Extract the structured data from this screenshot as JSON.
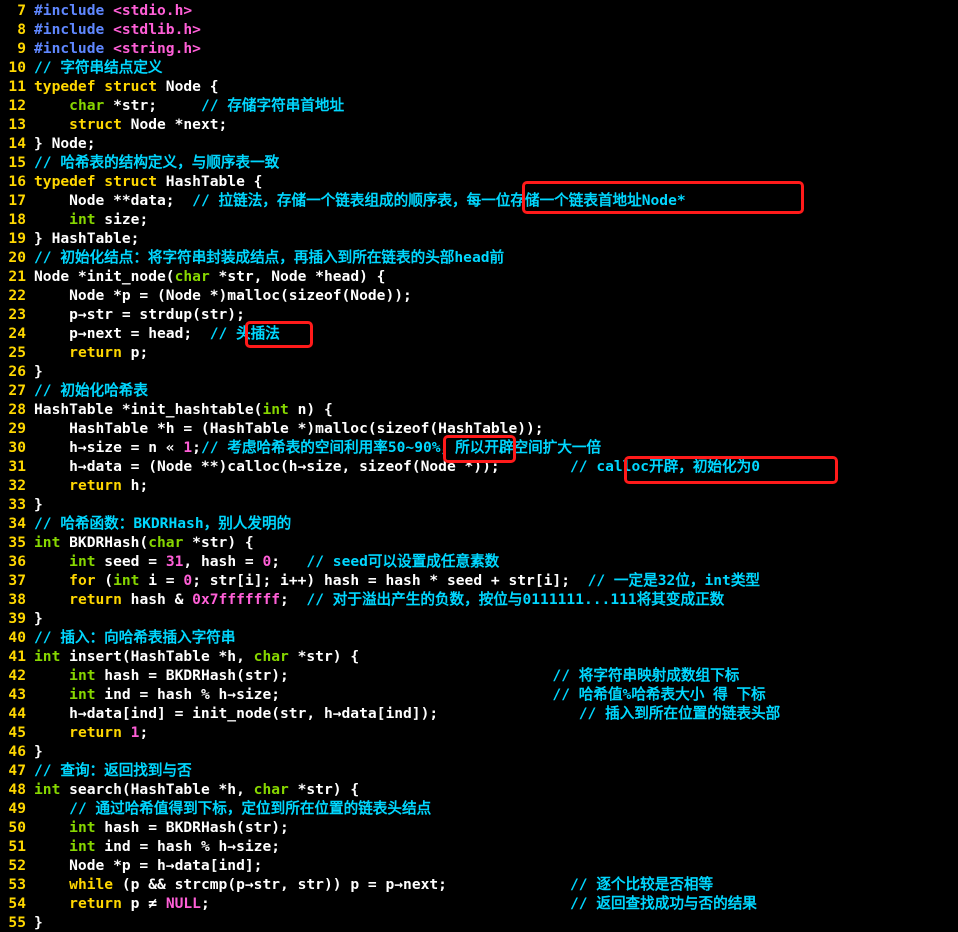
{
  "editor": {
    "lines": [
      {
        "n": "7",
        "segs": [
          [
            "#include ",
            "pre"
          ],
          [
            "<stdio.h>",
            "hdr"
          ]
        ]
      },
      {
        "n": "8",
        "segs": [
          [
            "#include ",
            "pre"
          ],
          [
            "<stdlib.h>",
            "hdr"
          ]
        ]
      },
      {
        "n": "9",
        "segs": [
          [
            "#include ",
            "pre"
          ],
          [
            "<string.h>",
            "hdr"
          ]
        ]
      },
      {
        "n": "10",
        "segs": [
          [
            "// 字符串结点定义",
            "cm"
          ]
        ]
      },
      {
        "n": "11",
        "segs": [
          [
            "typedef struct",
            "kw"
          ],
          [
            " Node {",
            "id"
          ]
        ]
      },
      {
        "n": "12",
        "segs": [
          [
            "    ",
            "id"
          ],
          [
            "char",
            "ty"
          ],
          [
            " *str;     ",
            "id"
          ],
          [
            "// 存储字符串首地址",
            "cm"
          ]
        ]
      },
      {
        "n": "13",
        "segs": [
          [
            "    ",
            "id"
          ],
          [
            "struct",
            "kw"
          ],
          [
            " Node *next;",
            "id"
          ]
        ]
      },
      {
        "n": "14",
        "segs": [
          [
            "} Node;",
            "id"
          ]
        ]
      },
      {
        "n": "15",
        "segs": [
          [
            "// 哈希表的结构定义，与顺序表一致",
            "cm"
          ]
        ]
      },
      {
        "n": "16",
        "segs": [
          [
            "typedef struct",
            "kw"
          ],
          [
            " HashTable {",
            "id"
          ]
        ]
      },
      {
        "n": "17",
        "segs": [
          [
            "    Node **data;  ",
            "id"
          ],
          [
            "// 拉链法，存储一个链表组成的顺序表，每一位存储一个链表首地址Node*",
            "cm"
          ]
        ]
      },
      {
        "n": "18",
        "segs": [
          [
            "    ",
            "id"
          ],
          [
            "int",
            "ty"
          ],
          [
            " size;",
            "id"
          ]
        ]
      },
      {
        "n": "19",
        "segs": [
          [
            "} HashTable;",
            "id"
          ]
        ]
      },
      {
        "n": "20",
        "segs": [
          [
            "// 初始化结点：将字符串封装成结点，再插入到所在链表的头部head前",
            "cm"
          ]
        ]
      },
      {
        "n": "21",
        "segs": [
          [
            "Node *init_node(",
            "id"
          ],
          [
            "char",
            "ty"
          ],
          [
            " *str, Node *head) {",
            "id"
          ]
        ]
      },
      {
        "n": "22",
        "segs": [
          [
            "    Node *p = (Node *)malloc(sizeof(Node));",
            "id"
          ]
        ]
      },
      {
        "n": "23",
        "segs": [
          [
            "    p→str = strdup(str);",
            "id"
          ]
        ]
      },
      {
        "n": "24",
        "segs": [
          [
            "    p→next = head;  ",
            "id"
          ],
          [
            "// 头插法",
            "cm"
          ]
        ]
      },
      {
        "n": "25",
        "segs": [
          [
            "    ",
            "id"
          ],
          [
            "return",
            "kw"
          ],
          [
            " p;",
            "id"
          ]
        ]
      },
      {
        "n": "26",
        "segs": [
          [
            "}",
            "id"
          ]
        ]
      },
      {
        "n": "27",
        "segs": [
          [
            "// 初始化哈希表",
            "cm"
          ]
        ]
      },
      {
        "n": "28",
        "segs": [
          [
            "HashTable *init_hashtable(",
            "id"
          ],
          [
            "int",
            "ty"
          ],
          [
            " n) {",
            "id"
          ]
        ]
      },
      {
        "n": "29",
        "segs": [
          [
            "    HashTable *h = (HashTable *)malloc(sizeof(HashTable));",
            "id"
          ]
        ]
      },
      {
        "n": "30",
        "segs": [
          [
            "    h→size = n « ",
            "id"
          ],
          [
            "1",
            "num"
          ],
          [
            ";",
            "id"
          ],
          [
            "// 考虑哈希表的空间利用率50~90%，所以开辟空间扩大一倍",
            "cm"
          ]
        ]
      },
      {
        "n": "31",
        "segs": [
          [
            "    h→data = (Node **)calloc(h→size, sizeof(Node *));        ",
            "id"
          ],
          [
            "// calloc开辟，初始化为0",
            "cm"
          ]
        ]
      },
      {
        "n": "32",
        "segs": [
          [
            "    ",
            "id"
          ],
          [
            "return",
            "kw"
          ],
          [
            " h;",
            "id"
          ]
        ]
      },
      {
        "n": "33",
        "segs": [
          [
            "}",
            "id"
          ]
        ]
      },
      {
        "n": "34",
        "segs": [
          [
            "// 哈希函数：BKDRHash，别人发明的",
            "cm"
          ]
        ]
      },
      {
        "n": "35",
        "segs": [
          [
            "int",
            "ty"
          ],
          [
            " BKDRHash(",
            "id"
          ],
          [
            "char",
            "ty"
          ],
          [
            " *str) {",
            "id"
          ]
        ]
      },
      {
        "n": "36",
        "segs": [
          [
            "    ",
            "id"
          ],
          [
            "int",
            "ty"
          ],
          [
            " seed = ",
            "id"
          ],
          [
            "31",
            "num"
          ],
          [
            ", hash = ",
            "id"
          ],
          [
            "0",
            "num"
          ],
          [
            ";   ",
            "id"
          ],
          [
            "// seed可以设置成任意素数",
            "cm"
          ]
        ]
      },
      {
        "n": "37",
        "segs": [
          [
            "    ",
            "id"
          ],
          [
            "for",
            "kw"
          ],
          [
            " (",
            "id"
          ],
          [
            "int",
            "ty"
          ],
          [
            " i = ",
            "id"
          ],
          [
            "0",
            "num"
          ],
          [
            "; str[i]; i++) hash = hash * seed + str[i];  ",
            "id"
          ],
          [
            "// 一定是32位，int类型",
            "cm"
          ]
        ]
      },
      {
        "n": "38",
        "segs": [
          [
            "    ",
            "id"
          ],
          [
            "return",
            "kw"
          ],
          [
            " hash & ",
            "id"
          ],
          [
            "0x7fffffff",
            "num"
          ],
          [
            ";  ",
            "id"
          ],
          [
            "// 对于溢出产生的负数，按位与0111111...111将其变成正数",
            "cm"
          ]
        ]
      },
      {
        "n": "39",
        "segs": [
          [
            "}",
            "id"
          ]
        ]
      },
      {
        "n": "40",
        "segs": [
          [
            "// 插入：向哈希表插入字符串",
            "cm"
          ]
        ]
      },
      {
        "n": "41",
        "segs": [
          [
            "int",
            "ty"
          ],
          [
            " insert(HashTable *h, ",
            "id"
          ],
          [
            "char",
            "ty"
          ],
          [
            " *str) {",
            "id"
          ]
        ]
      },
      {
        "n": "42",
        "segs": [
          [
            "    ",
            "id"
          ],
          [
            "int",
            "ty"
          ],
          [
            " hash = BKDRHash(str);                              ",
            "id"
          ],
          [
            "// 将字符串映射成数组下标",
            "cm"
          ]
        ]
      },
      {
        "n": "43",
        "segs": [
          [
            "    ",
            "id"
          ],
          [
            "int",
            "ty"
          ],
          [
            " ind = hash % h→size;                               ",
            "id"
          ],
          [
            "// 哈希值%哈希表大小 得 下标",
            "cm"
          ]
        ]
      },
      {
        "n": "44",
        "segs": [
          [
            "    h→data[ind] = init_node(str, h→data[ind]);                ",
            "id"
          ],
          [
            "// 插入到所在位置的链表头部",
            "cm"
          ]
        ]
      },
      {
        "n": "45",
        "segs": [
          [
            "    ",
            "id"
          ],
          [
            "return",
            "kw"
          ],
          [
            " ",
            "id"
          ],
          [
            "1",
            "num"
          ],
          [
            ";",
            "id"
          ]
        ]
      },
      {
        "n": "46",
        "segs": [
          [
            "}",
            "id"
          ]
        ]
      },
      {
        "n": "47",
        "segs": [
          [
            "// 查询：返回找到与否",
            "cm"
          ]
        ]
      },
      {
        "n": "48",
        "segs": [
          [
            "int",
            "ty"
          ],
          [
            " search(HashTable *h, ",
            "id"
          ],
          [
            "char",
            "ty"
          ],
          [
            " *str) {",
            "id"
          ]
        ]
      },
      {
        "n": "49",
        "segs": [
          [
            "    ",
            "id"
          ],
          [
            "// 通过哈希值得到下标，定位到所在位置的链表头结点",
            "cm"
          ]
        ]
      },
      {
        "n": "50",
        "segs": [
          [
            "    ",
            "id"
          ],
          [
            "int",
            "ty"
          ],
          [
            " hash = BKDRHash(str);",
            "id"
          ]
        ]
      },
      {
        "n": "51",
        "segs": [
          [
            "    ",
            "id"
          ],
          [
            "int",
            "ty"
          ],
          [
            " ind = hash % h→size;",
            "id"
          ]
        ]
      },
      {
        "n": "52",
        "segs": [
          [
            "    Node *p = h→data[ind];",
            "id"
          ]
        ]
      },
      {
        "n": "53",
        "segs": [
          [
            "    ",
            "id"
          ],
          [
            "while",
            "kw"
          ],
          [
            " (p && strcmp(p→str, str)) p = p→next;              ",
            "id"
          ],
          [
            "// 逐个比较是否相等",
            "cm"
          ]
        ]
      },
      {
        "n": "54",
        "segs": [
          [
            "    ",
            "id"
          ],
          [
            "return",
            "kw"
          ],
          [
            " p ≠ ",
            "id"
          ],
          [
            "NULL",
            "num"
          ],
          [
            ";                                         ",
            "id"
          ],
          [
            "// 返回查找成功与否的结果",
            "cm"
          ]
        ]
      },
      {
        "n": "55",
        "segs": [
          [
            "}",
            "id"
          ]
        ]
      }
    ]
  },
  "colors": {
    "background": "#000000",
    "line_number": "#ffd700",
    "keyword": "#ffd700",
    "preprocessor": "#5f87ff",
    "header": "#ff5fd7",
    "comment": "#00d7ff",
    "type": "#87d700",
    "number": "#ff5fd7",
    "identifier": "#ffffff",
    "highlight_box": "#ff1a1a"
  }
}
